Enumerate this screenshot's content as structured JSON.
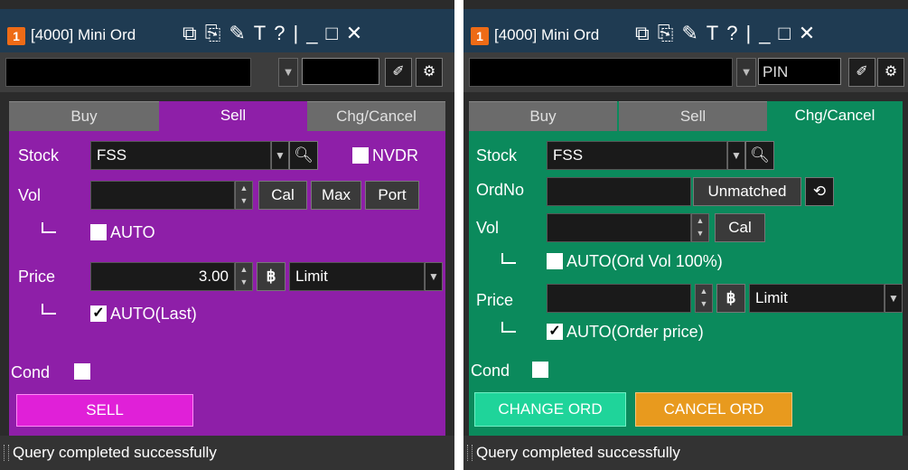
{
  "colors": {
    "titlebar": "#1f3b52",
    "sell_panel": "#8e1fa8",
    "change_panel": "#0b8a5c",
    "sell_button": "#e020d8",
    "change_button": "#1fd49a",
    "cancel_button": "#e89a1e"
  },
  "left": {
    "badge": "1",
    "title": "[4000] Mini Ord",
    "title_icons": [
      "restore-icon",
      "window-icon",
      "pin-tool-icon",
      "T",
      "?",
      "|",
      "_",
      "□",
      "✕"
    ],
    "tabs": {
      "buy": "Buy",
      "sell": "Sell",
      "chg": "Chg/Cancel"
    },
    "stock_label": "Stock",
    "stock_value": "FSS",
    "nvdr_label": "NVDR",
    "vol_label": "Vol",
    "vol_value": "",
    "cal": "Cal",
    "max": "Max",
    "port": "Port",
    "auto_label": "AUTO",
    "price_label": "Price",
    "price_value": "3.00",
    "baht": "฿",
    "order_type": "Limit",
    "auto_last": "AUTO(Last)",
    "cond_label": "Cond",
    "sell_btn": "SELL",
    "status": "Query completed successfully"
  },
  "right": {
    "badge": "1",
    "title": "[4000] Mini Ord",
    "pin_value": "PIN",
    "tabs": {
      "buy": "Buy",
      "sell": "Sell",
      "chg": "Chg/Cancel"
    },
    "stock_label": "Stock",
    "stock_value": "FSS",
    "ordno_label": "OrdNo",
    "ordno_value": "",
    "unmatched": "Unmatched",
    "vol_label": "Vol",
    "vol_value": "",
    "cal": "Cal",
    "auto_vol": "AUTO(Ord Vol 100%)",
    "price_label": "Price",
    "price_value": "",
    "baht": "฿",
    "order_type": "Limit",
    "auto_price": "AUTO(Order price)",
    "cond_label": "Cond",
    "change_btn": "CHANGE ORD",
    "cancel_btn": "CANCEL ORD",
    "status": "Query completed successfully"
  }
}
